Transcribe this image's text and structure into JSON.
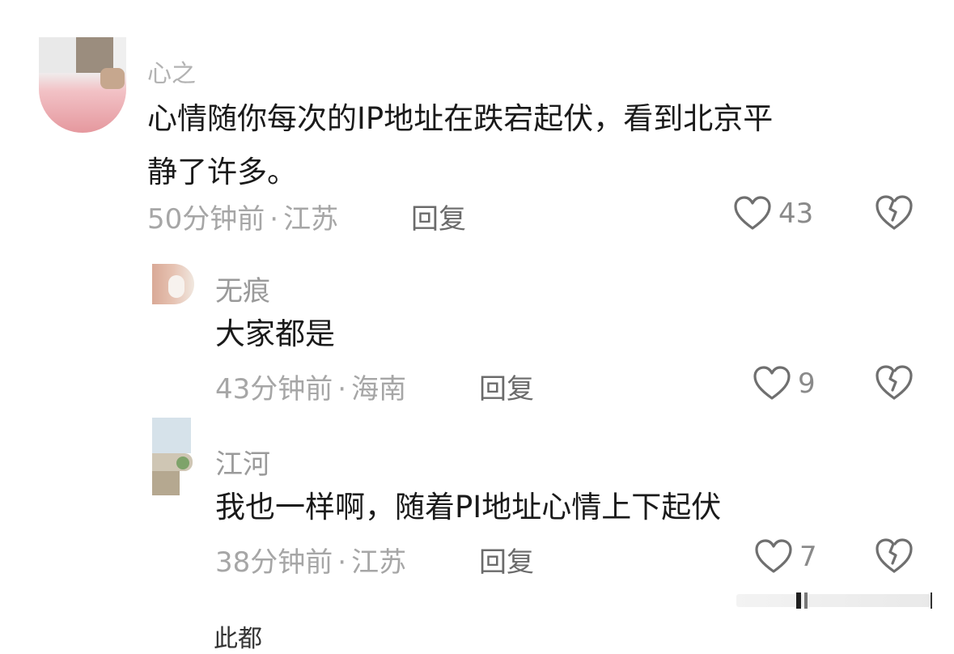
{
  "comments": [
    {
      "username": "心之",
      "text_line1": "心情随你每次的IP地址在跌宕起伏，看到北京平",
      "text_line2": "静了许多。",
      "time": "50分钟前",
      "location": "江苏",
      "reply_label": "回复",
      "likes": "43"
    }
  ],
  "replies": [
    {
      "username": "无痕",
      "text": "大家都是",
      "time": "43分钟前",
      "location": "海南",
      "reply_label": "回复",
      "likes": "9"
    },
    {
      "username": "江河",
      "text": "我也一样啊，随着PI地址心情上下起伏",
      "time": "38分钟前",
      "location": "江苏",
      "reply_label": "回复",
      "likes": "7"
    }
  ],
  "meta_separator": "·",
  "next_username_partial": "此都",
  "icons": {
    "like": "heart-outline-icon",
    "dislike": "broken-heart-icon"
  },
  "colors": {
    "text": "#1a1a1a",
    "meta": "#a6a6a6",
    "reply": "#6b6b6b",
    "icon": "#777777"
  }
}
